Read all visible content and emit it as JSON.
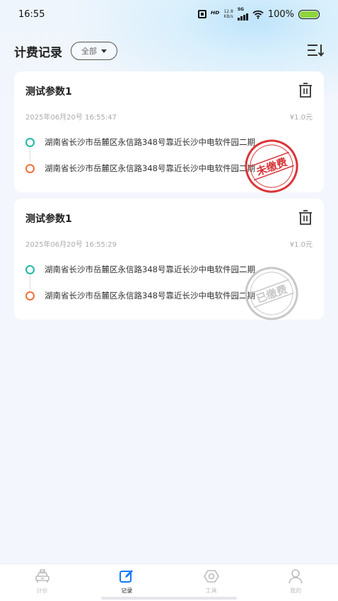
{
  "status_bar": {
    "time": "16:55",
    "net_speed_top": "12.8",
    "net_speed_unit": "KB/s",
    "net_type": "5G",
    "battery": "100%"
  },
  "header": {
    "title": "计费记录",
    "filter_label": "全部"
  },
  "records": [
    {
      "title": "测试参数1",
      "datetime": "2025年06月20号 16:55:47",
      "amount": "¥1.0元",
      "start": "湖南省长沙市岳麓区永信路348号靠近长沙中电软件园二期",
      "end": "湖南省长沙市岳麓区永信路348号靠近长沙中电软件园二期",
      "stamp_text": "未缴费",
      "stamp_color": "#d8363a"
    },
    {
      "title": "测试参数1",
      "datetime": "2025年06月20号 16:55:29",
      "amount": "¥1.0元",
      "start": "湖南省长沙市岳麓区永信路348号靠近长沙中电软件园二期",
      "end": "湖南省长沙市岳麓区永信路348号靠近长沙中电软件园二期",
      "stamp_text": "已缴费",
      "stamp_color": "#c8c8c8"
    }
  ],
  "tabs": [
    {
      "label": "计价",
      "icon": "taxi-icon"
    },
    {
      "label": "记录",
      "icon": "edit-icon"
    },
    {
      "label": "工具",
      "icon": "gear-icon"
    },
    {
      "label": "我的",
      "icon": "user-icon"
    }
  ],
  "colors": {
    "accent": "#1677ff",
    "start_dot": "#1fb9a8",
    "end_dot": "#f0703a"
  }
}
